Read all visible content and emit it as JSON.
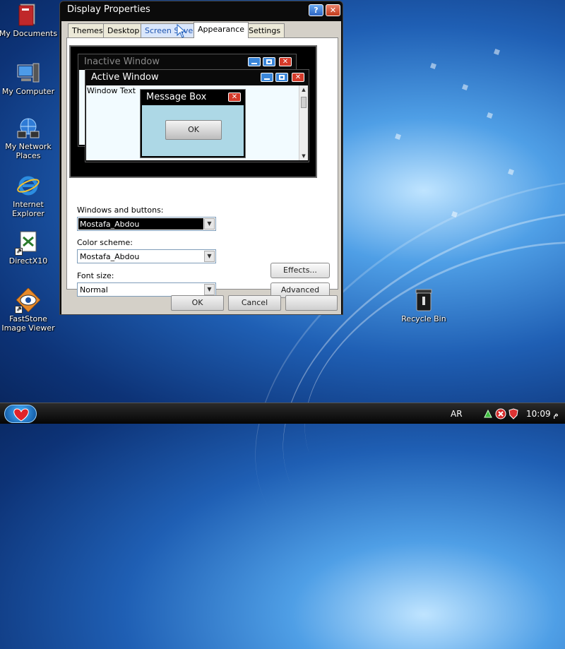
{
  "desktop": {
    "icons": [
      {
        "label": "My Documents",
        "icon": "folder-icon"
      },
      {
        "label": "My Computer",
        "icon": "computer-icon"
      },
      {
        "label": "My Network Places",
        "icon": "network-icon"
      },
      {
        "label": "Internet Explorer",
        "icon": "ie-icon"
      },
      {
        "label": "DirectX10",
        "icon": "directx-icon"
      },
      {
        "label": "FastStone Image Viewer",
        "icon": "eye-icon"
      },
      {
        "label": "Recycle Bin",
        "icon": "recycle-bin-icon"
      }
    ]
  },
  "window": {
    "title": "Display Properties",
    "help_label": "?",
    "close_label": "✕",
    "tabs": [
      "Themes",
      "Desktop",
      "Screen Saver",
      "Appearance",
      "Settings"
    ],
    "active_tab": "Appearance",
    "preview": {
      "inactive_title": "Inactive Window",
      "active_title": "Active Window",
      "window_text": "Window Text",
      "message_title": "Message Box",
      "ok_label": "OK"
    },
    "windows_buttons_label": "Windows and buttons:",
    "windows_buttons_value": "Mostafa_Abdou",
    "color_scheme_label": "Color scheme:",
    "color_scheme_value": "Mostafa_Abdou",
    "font_size_label": "Font size:",
    "font_size_value": "Normal",
    "effects_label": "Effects...",
    "advanced_label": "Advanced",
    "ok_label": "OK",
    "cancel_label": "Cancel",
    "apply_label": ""
  },
  "taskbar": {
    "language": "AR",
    "clock": "10:09 م"
  },
  "colors": {
    "preview_window_bg": "#f2fbff",
    "message_box_bg": "#add8e6",
    "close_red": "#d43a2a",
    "button_blue": "#3a86d9"
  }
}
